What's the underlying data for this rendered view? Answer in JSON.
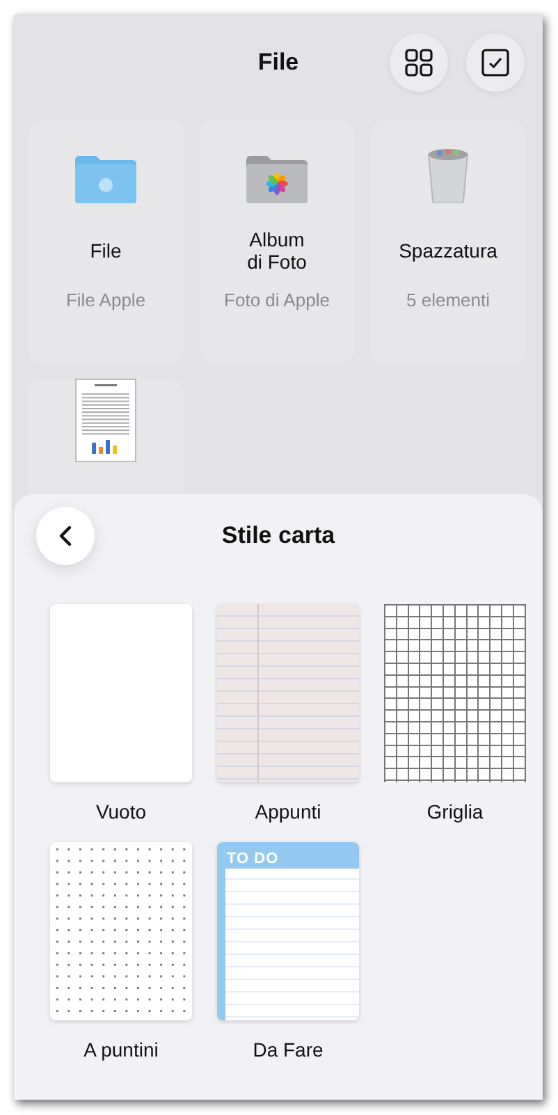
{
  "header": {
    "title": "File"
  },
  "locations": [
    {
      "kind": "apple-folder",
      "name": "File",
      "subtitle": "File Apple"
    },
    {
      "kind": "photos-folder",
      "name": "Album\ndi Foto",
      "subtitle": "Foto di Apple"
    },
    {
      "kind": "trash",
      "name": "Spazzatura",
      "subtitle": "5 elementi"
    },
    {
      "kind": "document"
    }
  ],
  "sheet": {
    "title": "Stile carta",
    "papers": [
      {
        "kind": "blank",
        "label": "Vuoto"
      },
      {
        "kind": "lined",
        "label": "Appunti"
      },
      {
        "kind": "grid",
        "label": "Griglia"
      },
      {
        "kind": "dotted",
        "label": "A puntini"
      },
      {
        "kind": "todo",
        "label": "Da Fare",
        "header": "TO DO"
      }
    ]
  }
}
